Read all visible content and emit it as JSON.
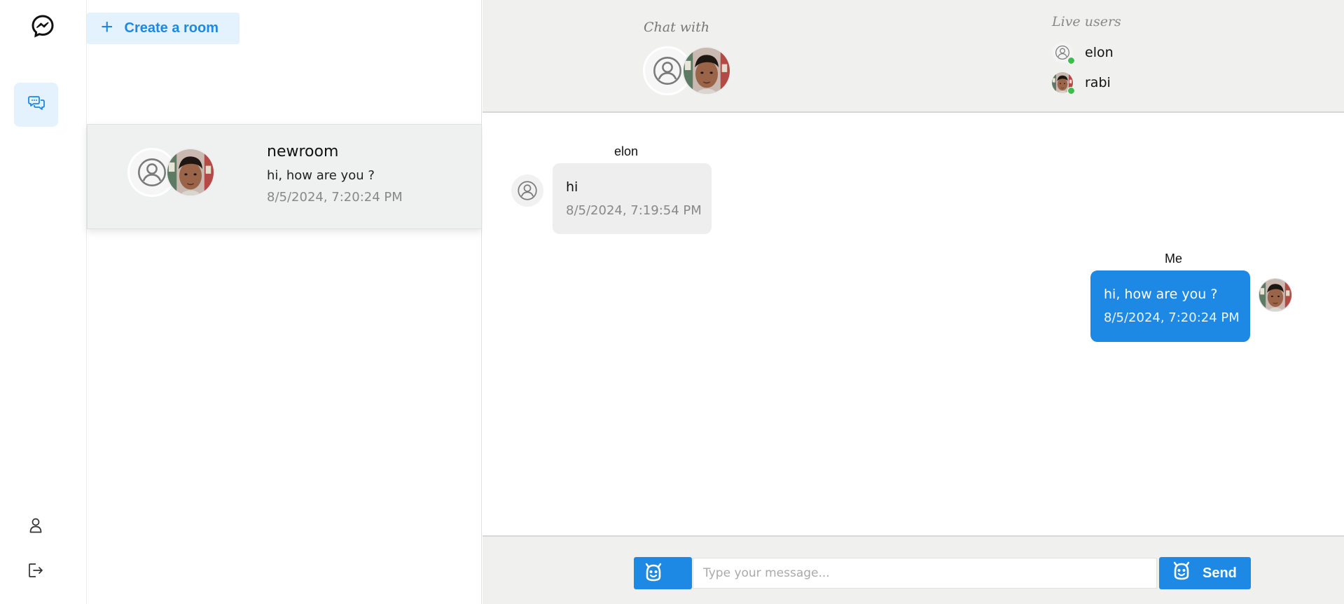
{
  "sidebar": {
    "logo_icon": "messenger-icon",
    "nav_chat_icon": "chat-bubbles-icon",
    "nav_user_icon": "user-icon",
    "nav_logout_icon": "logout-icon",
    "accent": "#1e88e5"
  },
  "rooms_panel": {
    "create_label": "Create a room",
    "create_icon": "plus-icon",
    "rooms": [
      {
        "name": "newroom",
        "last_message": "hi, how are you ?",
        "time": "8/5/2024, 7:20:24 PM",
        "avatars": [
          "default-avatar-icon",
          "user-photo"
        ]
      }
    ]
  },
  "chat": {
    "header": {
      "chat_with_label": "Chat with",
      "live_users_label": "Live users",
      "live_users": [
        {
          "name": "elon",
          "avatar": "default-avatar-icon",
          "online": true
        },
        {
          "name": "rabi",
          "avatar": "user-photo",
          "online": true
        }
      ]
    },
    "messages": [
      {
        "sender": "elon",
        "text": "hi",
        "time": "8/5/2024, 7:19:54 PM",
        "direction": "incoming"
      },
      {
        "sender": "Me",
        "text": "hi, how are you ?",
        "time": "8/5/2024, 7:20:24 PM",
        "direction": "outgoing"
      }
    ],
    "composer": {
      "emoji_icon": "emoji-icon",
      "placeholder": "Type your message...",
      "value": "",
      "send_label": "Send",
      "send_icon": "emoji-icon"
    }
  },
  "colors": {
    "accent": "#1e88e5",
    "online": "#3bbf4a",
    "header_bg": "#f0f0ef"
  }
}
